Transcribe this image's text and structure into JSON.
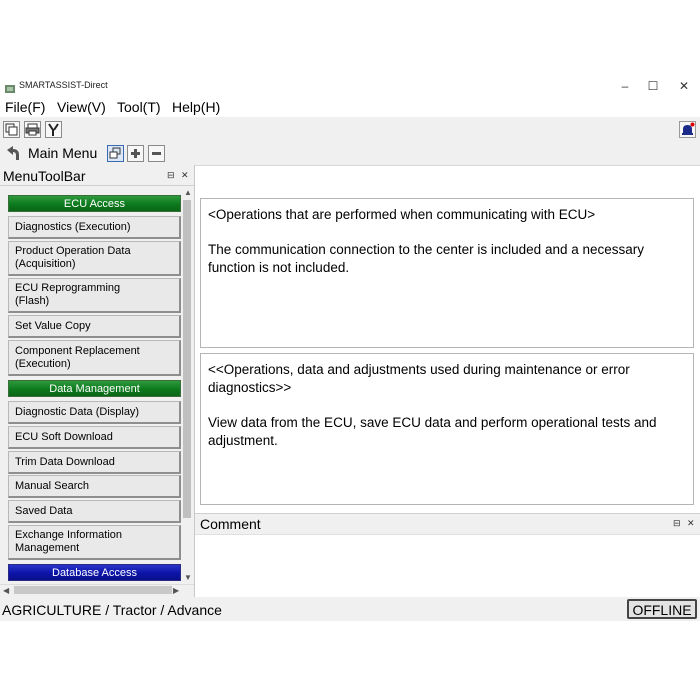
{
  "window": {
    "title": "SMARTASSIST-Direct",
    "controls": {
      "minimize": "–",
      "maximize": "☐",
      "close": "✕"
    }
  },
  "menubar": [
    "File(F)",
    "View(V)",
    "Tool(T)",
    "Help(H)"
  ],
  "toolbar2": {
    "label": "Main Menu"
  },
  "left_panel": {
    "title": "MenuToolBar",
    "controls": {
      "float": "⊟",
      "close": "✕"
    },
    "sections": {
      "ecu_access": "ECU Access",
      "data_management": "Data Management",
      "database_access": "Database Access"
    },
    "items": {
      "diagnostics": "Diagnostics (Execution)",
      "product_op_1": "Product Operation Data",
      "product_op_2": "(Acquisition)",
      "reprog_1": "ECU Reprogramming",
      "reprog_2": "(Flash)",
      "set_value": "Set Value Copy",
      "component_1": "Component Replacement",
      "component_2": "(Execution)",
      "diag_data": "Diagnostic Data (Display)",
      "soft_download": "ECU Soft Download",
      "trim_download": "Trim Data Download",
      "manual_search": "Manual Search",
      "saved_data": "Saved Data",
      "exchange_1": "Exchange Information",
      "exchange_2": "Management"
    }
  },
  "content": {
    "box1": {
      "heading": "<Operations that are performed when communicating with ECU>",
      "body": "The communication connection to the center is included and a necessary function is not included."
    },
    "box2": {
      "heading": "<<Operations, data and adjustments used during maintenance or error diagnostics>>",
      "body": "View data from the ECU, save ECU data and perform operational tests and adjustment."
    }
  },
  "comment_panel": {
    "title": "Comment"
  },
  "statusbar": {
    "path": "AGRICULTURE / Tractor / Advance",
    "mode": "OFFLINE"
  },
  "colors": {
    "section_green": "#0d7a1e",
    "section_blue": "#0c14a8",
    "notification_dot": "#e00000"
  }
}
